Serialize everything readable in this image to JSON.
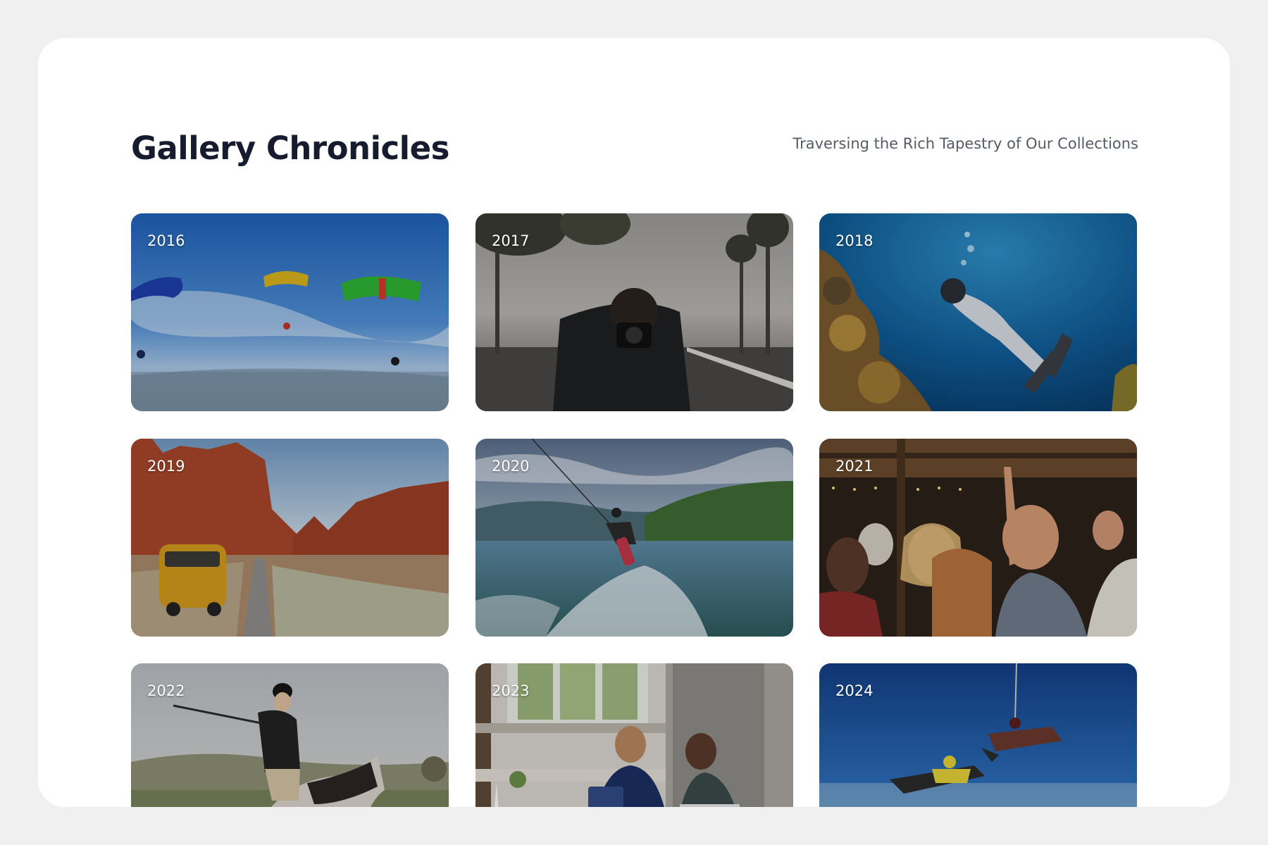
{
  "gallery": {
    "title": "Gallery Chronicles",
    "subtitle": "Traversing the Rich Tapestry of Our Collections",
    "cards": [
      {
        "year": "2016",
        "scene": "parachutists"
      },
      {
        "year": "2017",
        "scene": "photographer"
      },
      {
        "year": "2018",
        "scene": "scuba-diver"
      },
      {
        "year": "2019",
        "scene": "desert-van"
      },
      {
        "year": "2020",
        "scene": "wakeboarder"
      },
      {
        "year": "2021",
        "scene": "party-crowd"
      },
      {
        "year": "2022",
        "scene": "equestrian"
      },
      {
        "year": "2023",
        "scene": "kitchen-conversation"
      },
      {
        "year": "2024",
        "scene": "skydivers"
      }
    ]
  },
  "colors": {
    "page_background": "#f0f0f0",
    "card_background": "#ffffff",
    "title": "#161b2e",
    "subtitle": "#555b66",
    "year_label": "#ffffff"
  }
}
